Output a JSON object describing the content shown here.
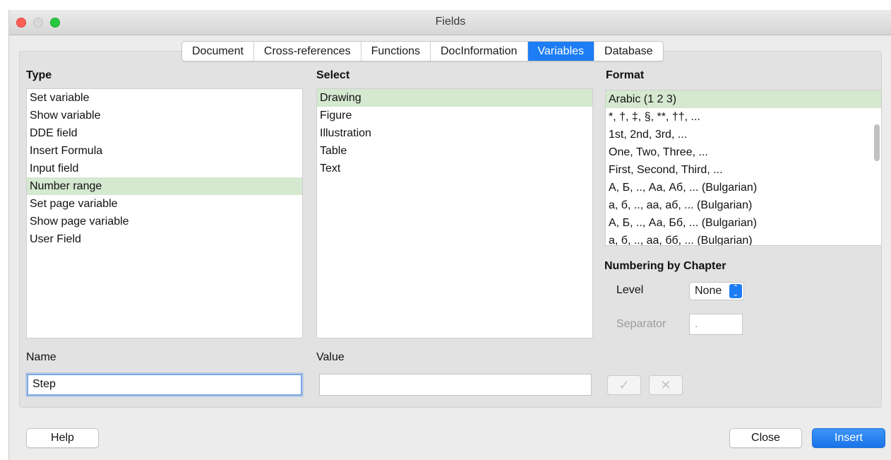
{
  "window": {
    "title": "Fields"
  },
  "tabs": [
    {
      "label": "Document",
      "active": false
    },
    {
      "label": "Cross-references",
      "active": false
    },
    {
      "label": "Functions",
      "active": false
    },
    {
      "label": "DocInformation",
      "active": false
    },
    {
      "label": "Variables",
      "active": true
    },
    {
      "label": "Database",
      "active": false
    }
  ],
  "type": {
    "label": "Type",
    "items": [
      "Set variable",
      "Show variable",
      "DDE field",
      "Insert Formula",
      "Input field",
      "Number range",
      "Set page variable",
      "Show page variable",
      "User Field"
    ],
    "selected": "Number range"
  },
  "select": {
    "label": "Select",
    "items": [
      "Drawing",
      "Figure",
      "Illustration",
      "Table",
      "Text"
    ],
    "selected": "Drawing"
  },
  "format": {
    "label": "Format",
    "items": [
      "Arabic (1 2 3)",
      "*, †, ‡, §, **, ††, ...",
      "1st, 2nd, 3rd, ...",
      "One, Two, Three, ...",
      "First, Second, Third, ...",
      "А, Б, .., Аа, Аб, ... (Bulgarian)",
      "а, б, .., аа, аб, ... (Bulgarian)",
      "А, Б, .., Аа, Бб, ... (Bulgarian)",
      "а, б, .., аа, бб, ... (Bulgarian)"
    ],
    "selected": "Arabic (1 2 3)"
  },
  "numbering": {
    "heading": "Numbering by Chapter",
    "level_label": "Level",
    "level_value": "None",
    "separator_label": "Separator",
    "separator_value": "."
  },
  "name": {
    "label": "Name",
    "value": "Step"
  },
  "value": {
    "label": "Value",
    "value": ""
  },
  "icons": {
    "apply": "checkmark-icon",
    "remove": "x-icon"
  },
  "buttons": {
    "help": "Help",
    "close": "Close",
    "insert": "Insert"
  },
  "colors": {
    "accent": "#1d7df5",
    "selection": "#d5e8d0"
  }
}
